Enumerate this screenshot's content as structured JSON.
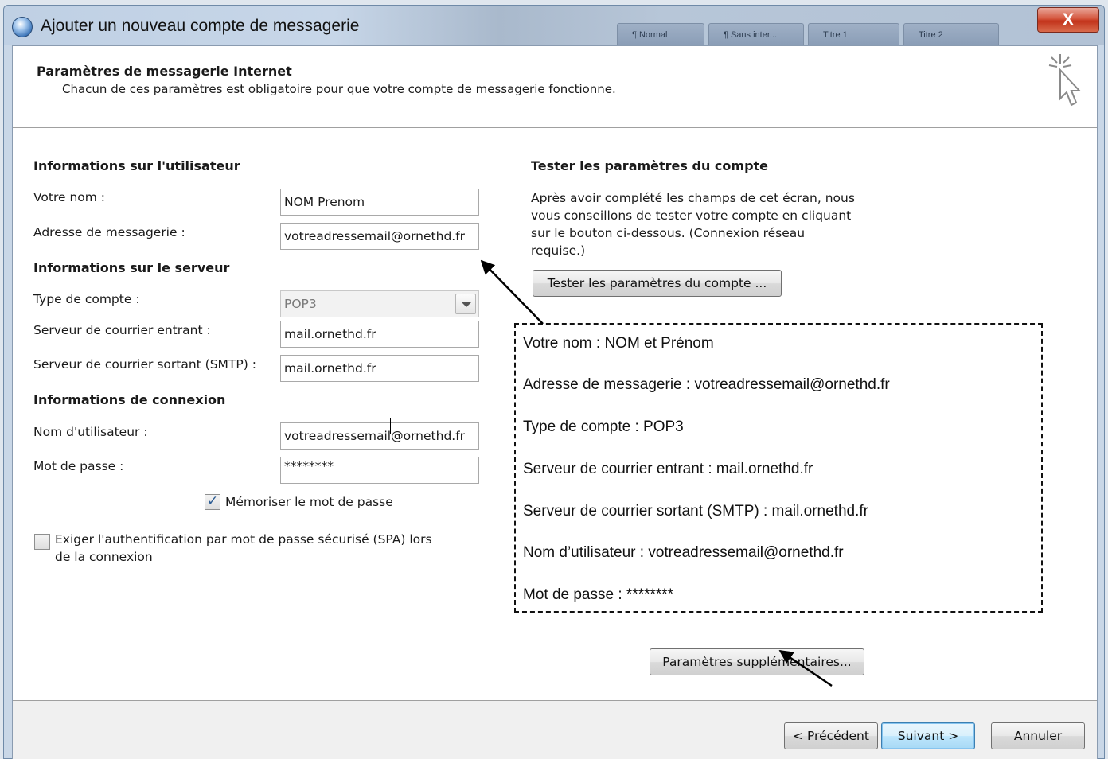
{
  "window": {
    "title": "Ajouter un nouveau compte de messagerie",
    "close_label": "X",
    "background_tabs": [
      "¶ Normal",
      "¶ Sans inter...",
      "Titre 1",
      "Titre 2"
    ]
  },
  "header": {
    "title": "Paramètres de messagerie Internet",
    "subtitle": "Chacun de ces paramètres est obligatoire pour que votre compte de messagerie fonctionne."
  },
  "user_info": {
    "section_title": "Informations sur l'utilisateur",
    "name_label": "Votre nom :",
    "name_value": "NOM Prenom",
    "email_label": "Adresse de messagerie :",
    "email_value": "votreadressemail@ornethd.fr"
  },
  "server_info": {
    "section_title": "Informations sur le serveur",
    "account_type_label": "Type de compte :",
    "account_type_value": "POP3",
    "incoming_label": "Serveur de courrier entrant :",
    "incoming_value": "mail.ornethd.fr",
    "outgoing_label": "Serveur de courrier sortant (SMTP) :",
    "outgoing_value": "mail.ornethd.fr"
  },
  "login_info": {
    "section_title": "Informations de connexion",
    "username_label": "Nom d'utilisateur :",
    "username_value": "votreadressemail@ornethd.fr",
    "password_label": "Mot de passe :",
    "password_value": "********",
    "remember_label": "Mémoriser le mot de passe",
    "remember_checked": true,
    "spa_label_line1": "Exiger l'authentification par mot de passe sécurisé (SPA) lors",
    "spa_label_line2": "de la connexion",
    "spa_checked": false
  },
  "test": {
    "section_title": "Tester les paramètres du compte",
    "description_lines": [
      "Après avoir complété les champs de cet écran, nous",
      "vous conseillons de tester votre compte en cliquant",
      "sur le bouton ci-dessous. (Connexion réseau",
      "requise.)"
    ],
    "button_label": "Tester les paramètres du compte ..."
  },
  "annotation": {
    "lines": [
      "Votre nom : NOM et Prénom",
      "Adresse de messagerie : votreadressemail@ornethd.fr",
      "Type de compte : POP3",
      "Serveur de courrier entrant : mail.ornethd.fr",
      "Serveur de courrier sortant (SMTP) : mail.ornethd.fr",
      "Nom d’utilisateur : votreadressemail@ornethd.fr",
      "Mot de passe : ********"
    ]
  },
  "more_settings_label": "Paramètres supplémentaires...",
  "footer": {
    "back_label": "< Précédent",
    "next_label": "Suivant >",
    "cancel_label": "Annuler"
  },
  "colors": {
    "default_button_border": "#3c7fb1",
    "close_button": "#c2331b",
    "checkmark": "#2e5e95"
  }
}
